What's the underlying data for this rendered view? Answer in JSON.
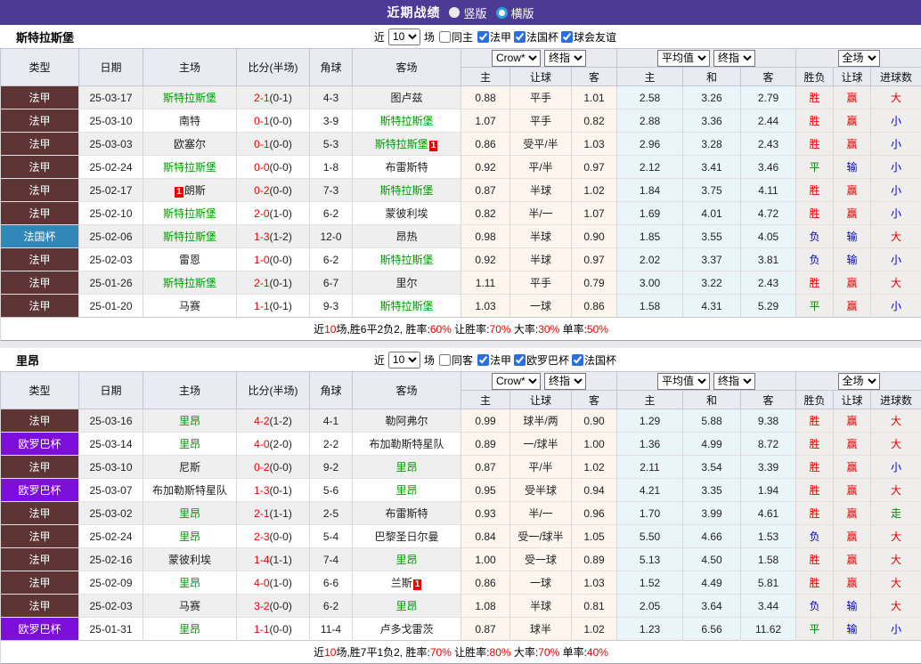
{
  "title_bar": {
    "title": "近期战绩",
    "radio_vertical": "竖版",
    "radio_horizontal": "横版"
  },
  "colors": {
    "topbar": "#4b3b94",
    "ligue1_badge": "#5e3434",
    "coupe_badge": "#3087b8",
    "europa_badge": "#7c10da",
    "red": "#e60000",
    "blue": "#0000cc",
    "green": "#008800",
    "team_green": "#009900",
    "header_bg": "#e9eaf2",
    "row_alt": "#efefef",
    "odds1_bg": "#fdf5ee",
    "odds2_bg": "#eaf5fa",
    "result_bg": "#efeeec"
  },
  "sections": [
    {
      "team": "斯特拉斯堡",
      "filter": {
        "near_label": "近",
        "games_value": "10",
        "games_label": "场",
        "same_label": "同主",
        "leagues": [
          {
            "label": "法甲",
            "checked": true
          },
          {
            "label": "法国杯",
            "checked": true
          },
          {
            "label": "球会友谊",
            "checked": true
          }
        ]
      },
      "header": {
        "main_cols": [
          "类型",
          "日期",
          "主场",
          "比分(半场)",
          "角球",
          "客场"
        ],
        "odds1_select_a": "Crow*",
        "odds1_select_b": "终指",
        "odds1_cols": [
          "主",
          "让球",
          "客"
        ],
        "odds2_select_a": "平均值",
        "odds2_select_b": "终指",
        "odds2_cols": [
          "主",
          "和",
          "客"
        ],
        "result_select": "全场",
        "result_cols": [
          "胜负",
          "让球",
          "进球数"
        ]
      },
      "rows": [
        {
          "type": "法甲",
          "type_cls": "t-ligue1",
          "date": "25-03-17",
          "home": "斯特拉斯堡",
          "home_cls": "teamgreen",
          "home_badge_pre": "",
          "home_badge_post": "",
          "score": "2-1",
          "half": "(0-1)",
          "corner": "4-3",
          "away": "图卢兹",
          "away_cls": "",
          "away_badge_pre": "",
          "away_badge_post": "",
          "h_odds": "0.88",
          "handicap": "平手",
          "a_odds": "1.01",
          "avg_h": "2.58",
          "avg_d": "3.26",
          "avg_a": "2.79",
          "wl": "胜",
          "wl_cls": "red",
          "hcres": "赢",
          "hcres_cls": "red",
          "goals": "大",
          "goals_cls": "red"
        },
        {
          "type": "法甲",
          "type_cls": "t-ligue1",
          "date": "25-03-10",
          "home": "南特",
          "home_cls": "",
          "home_badge_pre": "",
          "home_badge_post": "",
          "score": "0-1",
          "half": "(0-0)",
          "corner": "3-9",
          "away": "斯特拉斯堡",
          "away_cls": "teamgreen",
          "away_badge_pre": "",
          "away_badge_post": "",
          "h_odds": "1.07",
          "handicap": "平手",
          "a_odds": "0.82",
          "avg_h": "2.88",
          "avg_d": "3.36",
          "avg_a": "2.44",
          "wl": "胜",
          "wl_cls": "red",
          "hcres": "赢",
          "hcres_cls": "red",
          "goals": "小",
          "goals_cls": "blue"
        },
        {
          "type": "法甲",
          "type_cls": "t-ligue1",
          "date": "25-03-03",
          "home": "欧塞尔",
          "home_cls": "",
          "home_badge_pre": "",
          "home_badge_post": "",
          "score": "0-1",
          "half": "(0-0)",
          "corner": "5-3",
          "away": "斯特拉斯堡",
          "away_cls": "teamgreen",
          "away_badge_pre": "",
          "away_badge_post": "1",
          "h_odds": "0.86",
          "handicap": "受平/半",
          "a_odds": "1.03",
          "avg_h": "2.96",
          "avg_d": "3.28",
          "avg_a": "2.43",
          "wl": "胜",
          "wl_cls": "red",
          "hcres": "赢",
          "hcres_cls": "red",
          "goals": "小",
          "goals_cls": "blue"
        },
        {
          "type": "法甲",
          "type_cls": "t-ligue1",
          "date": "25-02-24",
          "home": "斯特拉斯堡",
          "home_cls": "teamgreen",
          "home_badge_pre": "",
          "home_badge_post": "",
          "score": "0-0",
          "half": "(0-0)",
          "corner": "1-8",
          "away": "布雷斯特",
          "away_cls": "",
          "away_badge_pre": "",
          "away_badge_post": "",
          "h_odds": "0.92",
          "handicap": "平/半",
          "a_odds": "0.97",
          "avg_h": "2.12",
          "avg_d": "3.41",
          "avg_a": "3.46",
          "wl": "平",
          "wl_cls": "green",
          "hcres": "输",
          "hcres_cls": "blue",
          "goals": "小",
          "goals_cls": "blue"
        },
        {
          "type": "法甲",
          "type_cls": "t-ligue1",
          "date": "25-02-17",
          "home": "朗斯",
          "home_cls": "",
          "home_badge_pre": "1",
          "home_badge_post": "",
          "score": "0-2",
          "half": "(0-0)",
          "corner": "7-3",
          "away": "斯特拉斯堡",
          "away_cls": "teamgreen",
          "away_badge_pre": "",
          "away_badge_post": "",
          "h_odds": "0.87",
          "handicap": "半球",
          "a_odds": "1.02",
          "avg_h": "1.84",
          "avg_d": "3.75",
          "avg_a": "4.11",
          "wl": "胜",
          "wl_cls": "red",
          "hcres": "赢",
          "hcres_cls": "red",
          "goals": "小",
          "goals_cls": "blue"
        },
        {
          "type": "法甲",
          "type_cls": "t-ligue1",
          "date": "25-02-10",
          "home": "斯特拉斯堡",
          "home_cls": "teamgreen",
          "home_badge_pre": "",
          "home_badge_post": "",
          "score": "2-0",
          "half": "(1-0)",
          "corner": "6-2",
          "away": "蒙彼利埃",
          "away_cls": "",
          "away_badge_pre": "",
          "away_badge_post": "",
          "h_odds": "0.82",
          "handicap": "半/一",
          "a_odds": "1.07",
          "avg_h": "1.69",
          "avg_d": "4.01",
          "avg_a": "4.72",
          "wl": "胜",
          "wl_cls": "red",
          "hcres": "赢",
          "hcres_cls": "red",
          "goals": "小",
          "goals_cls": "blue"
        },
        {
          "type": "法国杯",
          "type_cls": "t-coupe",
          "date": "25-02-06",
          "home": "斯特拉斯堡",
          "home_cls": "teamgreen",
          "home_badge_pre": "",
          "home_badge_post": "",
          "score": "1-3",
          "half": "(1-2)",
          "corner": "12-0",
          "away": "昂热",
          "away_cls": "",
          "away_badge_pre": "",
          "away_badge_post": "",
          "h_odds": "0.98",
          "handicap": "半球",
          "a_odds": "0.90",
          "avg_h": "1.85",
          "avg_d": "3.55",
          "avg_a": "4.05",
          "wl": "负",
          "wl_cls": "blue",
          "hcres": "输",
          "hcres_cls": "blue",
          "goals": "大",
          "goals_cls": "red"
        },
        {
          "type": "法甲",
          "type_cls": "t-ligue1",
          "date": "25-02-03",
          "home": "雷恩",
          "home_cls": "",
          "home_badge_pre": "",
          "home_badge_post": "",
          "score": "1-0",
          "half": "(0-0)",
          "corner": "6-2",
          "away": "斯特拉斯堡",
          "away_cls": "teamgreen",
          "away_badge_pre": "",
          "away_badge_post": "",
          "h_odds": "0.92",
          "handicap": "半球",
          "a_odds": "0.97",
          "avg_h": "2.02",
          "avg_d": "3.37",
          "avg_a": "3.81",
          "wl": "负",
          "wl_cls": "blue",
          "hcres": "输",
          "hcres_cls": "blue",
          "goals": "小",
          "goals_cls": "blue"
        },
        {
          "type": "法甲",
          "type_cls": "t-ligue1",
          "date": "25-01-26",
          "home": "斯特拉斯堡",
          "home_cls": "teamgreen",
          "home_badge_pre": "",
          "home_badge_post": "",
          "score": "2-1",
          "half": "(0-1)",
          "corner": "6-7",
          "away": "里尔",
          "away_cls": "",
          "away_badge_pre": "",
          "away_badge_post": "",
          "h_odds": "1.11",
          "handicap": "平手",
          "a_odds": "0.79",
          "avg_h": "3.00",
          "avg_d": "3.22",
          "avg_a": "2.43",
          "wl": "胜",
          "wl_cls": "red",
          "hcres": "赢",
          "hcres_cls": "red",
          "goals": "大",
          "goals_cls": "red"
        },
        {
          "type": "法甲",
          "type_cls": "t-ligue1",
          "date": "25-01-20",
          "home": "马赛",
          "home_cls": "",
          "home_badge_pre": "",
          "home_badge_post": "",
          "score": "1-1",
          "half": "(0-1)",
          "corner": "9-3",
          "away": "斯特拉斯堡",
          "away_cls": "teamgreen",
          "away_badge_pre": "",
          "away_badge_post": "",
          "h_odds": "1.03",
          "handicap": "一球",
          "a_odds": "0.86",
          "avg_h": "1.58",
          "avg_d": "4.31",
          "avg_a": "5.29",
          "wl": "平",
          "wl_cls": "green",
          "hcres": "赢",
          "hcres_cls": "red",
          "goals": "小",
          "goals_cls": "blue"
        }
      ],
      "summary": [
        {
          "t": "近",
          "cls": ""
        },
        {
          "t": "10",
          "cls": "red"
        },
        {
          "t": "场,胜6平2负2, 胜率:",
          "cls": ""
        },
        {
          "t": "60%",
          "cls": "red"
        },
        {
          "t": " 让胜率:",
          "cls": ""
        },
        {
          "t": "70%",
          "cls": "red"
        },
        {
          "t": " 大率:",
          "cls": ""
        },
        {
          "t": "30%",
          "cls": "red"
        },
        {
          "t": " 单率:",
          "cls": ""
        },
        {
          "t": "50%",
          "cls": "red"
        }
      ]
    },
    {
      "team": "里昂",
      "filter": {
        "near_label": "近",
        "games_value": "10",
        "games_label": "场",
        "same_label": "同客",
        "leagues": [
          {
            "label": "法甲",
            "checked": true
          },
          {
            "label": "欧罗巴杯",
            "checked": true
          },
          {
            "label": "法国杯",
            "checked": true
          }
        ]
      },
      "header": {
        "main_cols": [
          "类型",
          "日期",
          "主场",
          "比分(半场)",
          "角球",
          "客场"
        ],
        "odds1_select_a": "Crow*",
        "odds1_select_b": "终指",
        "odds1_cols": [
          "主",
          "让球",
          "客"
        ],
        "odds2_select_a": "平均值",
        "odds2_select_b": "终指",
        "odds2_cols": [
          "主",
          "和",
          "客"
        ],
        "result_select": "全场",
        "result_cols": [
          "胜负",
          "让球",
          "进球数"
        ]
      },
      "rows": [
        {
          "type": "法甲",
          "type_cls": "t-ligue1",
          "date": "25-03-16",
          "home": "里昂",
          "home_cls": "teamgreen",
          "home_badge_pre": "",
          "home_badge_post": "",
          "score": "4-2",
          "half": "(1-2)",
          "corner": "4-1",
          "away": "勒阿弗尔",
          "away_cls": "",
          "away_badge_pre": "",
          "away_badge_post": "",
          "h_odds": "0.99",
          "handicap": "球半/两",
          "a_odds": "0.90",
          "avg_h": "1.29",
          "avg_d": "5.88",
          "avg_a": "9.38",
          "wl": "胜",
          "wl_cls": "red",
          "hcres": "赢",
          "hcres_cls": "red",
          "goals": "大",
          "goals_cls": "red"
        },
        {
          "type": "欧罗巴杯",
          "type_cls": "t-europa",
          "date": "25-03-14",
          "home": "里昂",
          "home_cls": "teamgreen",
          "home_badge_pre": "",
          "home_badge_post": "",
          "score": "4-0",
          "half": "(2-0)",
          "corner": "2-2",
          "away": "布加勒斯特星队",
          "away_cls": "",
          "away_badge_pre": "",
          "away_badge_post": "",
          "h_odds": "0.89",
          "handicap": "一/球半",
          "a_odds": "1.00",
          "avg_h": "1.36",
          "avg_d": "4.99",
          "avg_a": "8.72",
          "wl": "胜",
          "wl_cls": "red",
          "hcres": "赢",
          "hcres_cls": "red",
          "goals": "大",
          "goals_cls": "red"
        },
        {
          "type": "法甲",
          "type_cls": "t-ligue1",
          "date": "25-03-10",
          "home": "尼斯",
          "home_cls": "",
          "home_badge_pre": "",
          "home_badge_post": "",
          "score": "0-2",
          "half": "(0-0)",
          "corner": "9-2",
          "away": "里昂",
          "away_cls": "teamgreen",
          "away_badge_pre": "",
          "away_badge_post": "",
          "h_odds": "0.87",
          "handicap": "平/半",
          "a_odds": "1.02",
          "avg_h": "2.11",
          "avg_d": "3.54",
          "avg_a": "3.39",
          "wl": "胜",
          "wl_cls": "red",
          "hcres": "赢",
          "hcres_cls": "red",
          "goals": "小",
          "goals_cls": "blue"
        },
        {
          "type": "欧罗巴杯",
          "type_cls": "t-europa",
          "date": "25-03-07",
          "home": "布加勒斯特星队",
          "home_cls": "",
          "home_badge_pre": "",
          "home_badge_post": "",
          "score": "1-3",
          "half": "(0-1)",
          "corner": "5-6",
          "away": "里昂",
          "away_cls": "teamgreen",
          "away_badge_pre": "",
          "away_badge_post": "",
          "h_odds": "0.95",
          "handicap": "受半球",
          "a_odds": "0.94",
          "avg_h": "4.21",
          "avg_d": "3.35",
          "avg_a": "1.94",
          "wl": "胜",
          "wl_cls": "red",
          "hcres": "赢",
          "hcres_cls": "red",
          "goals": "大",
          "goals_cls": "red"
        },
        {
          "type": "法甲",
          "type_cls": "t-ligue1",
          "date": "25-03-02",
          "home": "里昂",
          "home_cls": "teamgreen",
          "home_badge_pre": "",
          "home_badge_post": "",
          "score": "2-1",
          "half": "(1-1)",
          "corner": "2-5",
          "away": "布雷斯特",
          "away_cls": "",
          "away_badge_pre": "",
          "away_badge_post": "",
          "h_odds": "0.93",
          "handicap": "半/一",
          "a_odds": "0.96",
          "avg_h": "1.70",
          "avg_d": "3.99",
          "avg_a": "4.61",
          "wl": "胜",
          "wl_cls": "red",
          "hcres": "赢",
          "hcres_cls": "red",
          "goals": "走",
          "goals_cls": "green"
        },
        {
          "type": "法甲",
          "type_cls": "t-ligue1",
          "date": "25-02-24",
          "home": "里昂",
          "home_cls": "teamgreen",
          "home_badge_pre": "",
          "home_badge_post": "",
          "score": "2-3",
          "half": "(0-0)",
          "corner": "5-4",
          "away": "巴黎圣日尔曼",
          "away_cls": "",
          "away_badge_pre": "",
          "away_badge_post": "",
          "h_odds": "0.84",
          "handicap": "受一/球半",
          "a_odds": "1.05",
          "avg_h": "5.50",
          "avg_d": "4.66",
          "avg_a": "1.53",
          "wl": "负",
          "wl_cls": "blue",
          "hcres": "赢",
          "hcres_cls": "red",
          "goals": "大",
          "goals_cls": "red"
        },
        {
          "type": "法甲",
          "type_cls": "t-ligue1",
          "date": "25-02-16",
          "home": "蒙彼利埃",
          "home_cls": "",
          "home_badge_pre": "",
          "home_badge_post": "",
          "score": "1-4",
          "half": "(1-1)",
          "corner": "7-4",
          "away": "里昂",
          "away_cls": "teamgreen",
          "away_badge_pre": "",
          "away_badge_post": "",
          "h_odds": "1.00",
          "handicap": "受一球",
          "a_odds": "0.89",
          "avg_h": "5.13",
          "avg_d": "4.50",
          "avg_a": "1.58",
          "wl": "胜",
          "wl_cls": "red",
          "hcres": "赢",
          "hcres_cls": "red",
          "goals": "大",
          "goals_cls": "red"
        },
        {
          "type": "法甲",
          "type_cls": "t-ligue1",
          "date": "25-02-09",
          "home": "里昂",
          "home_cls": "teamgreen",
          "home_badge_pre": "",
          "home_badge_post": "",
          "score": "4-0",
          "half": "(1-0)",
          "corner": "6-6",
          "away": "兰斯",
          "away_cls": "",
          "away_badge_pre": "",
          "away_badge_post": "1",
          "h_odds": "0.86",
          "handicap": "一球",
          "a_odds": "1.03",
          "avg_h": "1.52",
          "avg_d": "4.49",
          "avg_a": "5.81",
          "wl": "胜",
          "wl_cls": "red",
          "hcres": "赢",
          "hcres_cls": "red",
          "goals": "大",
          "goals_cls": "red"
        },
        {
          "type": "法甲",
          "type_cls": "t-ligue1",
          "date": "25-02-03",
          "home": "马赛",
          "home_cls": "",
          "home_badge_pre": "",
          "home_badge_post": "",
          "score": "3-2",
          "half": "(0-0)",
          "corner": "6-2",
          "away": "里昂",
          "away_cls": "teamgreen",
          "away_badge_pre": "",
          "away_badge_post": "",
          "h_odds": "1.08",
          "handicap": "半球",
          "a_odds": "0.81",
          "avg_h": "2.05",
          "avg_d": "3.64",
          "avg_a": "3.44",
          "wl": "负",
          "wl_cls": "blue",
          "hcres": "输",
          "hcres_cls": "blue",
          "goals": "大",
          "goals_cls": "red"
        },
        {
          "type": "欧罗巴杯",
          "type_cls": "t-europa",
          "date": "25-01-31",
          "home": "里昂",
          "home_cls": "teamgreen",
          "home_badge_pre": "",
          "home_badge_post": "",
          "score": "1-1",
          "half": "(0-0)",
          "corner": "11-4",
          "away": "卢多戈雷茨",
          "away_cls": "",
          "away_badge_pre": "",
          "away_badge_post": "",
          "h_odds": "0.87",
          "handicap": "球半",
          "a_odds": "1.02",
          "avg_h": "1.23",
          "avg_d": "6.56",
          "avg_a": "11.62",
          "wl": "平",
          "wl_cls": "green",
          "hcres": "输",
          "hcres_cls": "blue",
          "goals": "小",
          "goals_cls": "blue"
        }
      ],
      "summary": [
        {
          "t": "近",
          "cls": ""
        },
        {
          "t": "10",
          "cls": "red"
        },
        {
          "t": "场,胜7平1负2, 胜率:",
          "cls": ""
        },
        {
          "t": "70%",
          "cls": "red"
        },
        {
          "t": " 让胜率:",
          "cls": ""
        },
        {
          "t": "80%",
          "cls": "red"
        },
        {
          "t": " 大率:",
          "cls": ""
        },
        {
          "t": "70%",
          "cls": "red"
        },
        {
          "t": " 单率:",
          "cls": ""
        },
        {
          "t": "40%",
          "cls": "red"
        }
      ]
    }
  ]
}
